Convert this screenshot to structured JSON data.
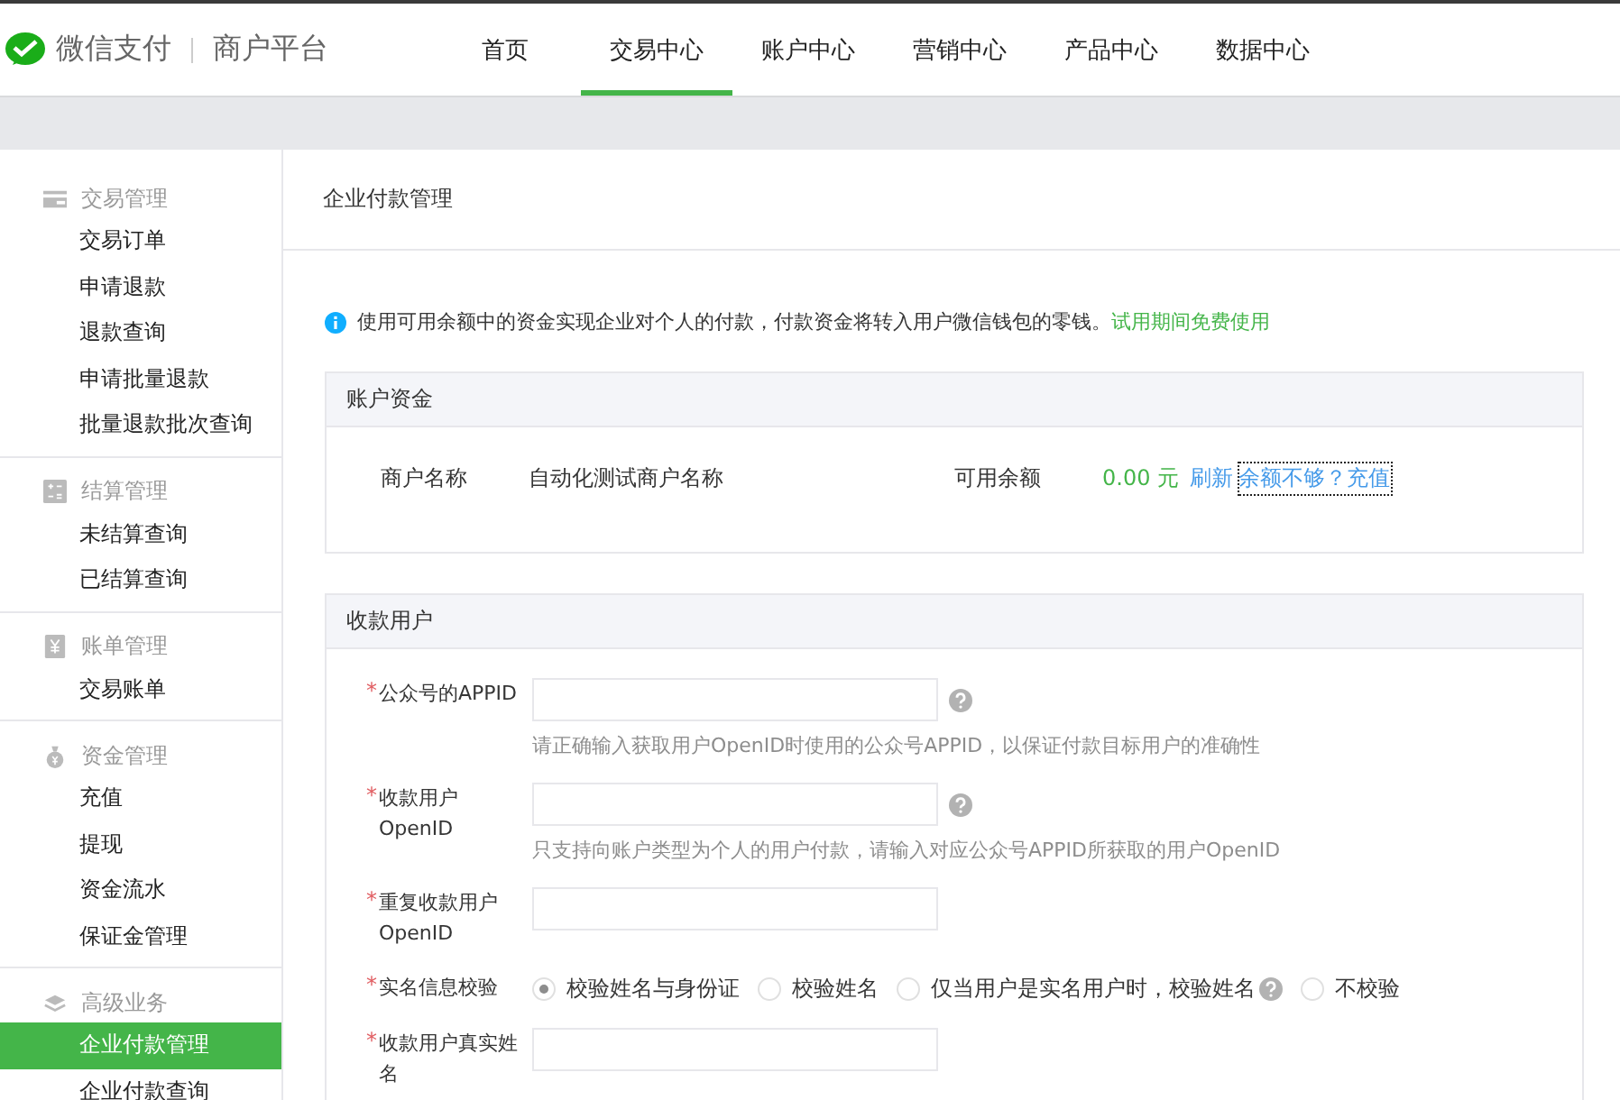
{
  "header": {
    "brand": "微信支付",
    "platform": "商户平台",
    "nav": [
      {
        "label": "首页",
        "selected": false
      },
      {
        "label": "交易中心",
        "selected": true
      },
      {
        "label": "账户中心",
        "selected": false
      },
      {
        "label": "营销中心",
        "selected": false
      },
      {
        "label": "产品中心",
        "selected": false
      },
      {
        "label": "数据中心",
        "selected": false
      }
    ]
  },
  "sidebar": {
    "groups": [
      {
        "title": "交易管理",
        "kind": "card",
        "items": [
          {
            "label": "交易订单",
            "selected": false
          },
          {
            "label": "申请退款",
            "selected": false
          },
          {
            "label": "退款查询",
            "selected": false
          },
          {
            "label": "申请批量退款",
            "selected": false
          },
          {
            "label": "批量退款批次查询",
            "selected": false
          }
        ]
      },
      {
        "title": "结算管理",
        "kind": "calculator",
        "items": [
          {
            "label": "未结算查询",
            "selected": false
          },
          {
            "label": "已结算查询",
            "selected": false
          }
        ]
      },
      {
        "title": "账单管理",
        "kind": "bill",
        "items": [
          {
            "label": "交易账单",
            "selected": false
          }
        ]
      },
      {
        "title": "资金管理",
        "kind": "bag",
        "items": [
          {
            "label": "充值",
            "selected": false
          },
          {
            "label": "提现",
            "selected": false
          },
          {
            "label": "资金流水",
            "selected": false
          },
          {
            "label": "保证金管理",
            "selected": false
          }
        ]
      },
      {
        "title": "高级业务",
        "kind": "layers",
        "items": [
          {
            "label": "企业付款管理",
            "selected": true
          },
          {
            "label": "企业付款查询",
            "selected": false
          }
        ]
      }
    ]
  },
  "content": {
    "title": "企业付款管理",
    "notice": {
      "text": "使用可用余额中的资金实现企业对个人的付款，付款资金将转入用户微信钱包的零钱。",
      "link": "试用期间免费使用"
    },
    "account_panel": {
      "title": "账户资金",
      "name_label": "商户名称",
      "name_value": "自动化测试商户名称",
      "balance_label": "可用余额",
      "balance_value": "0.00 元",
      "refresh": "刷新",
      "recharge": {
        "label": "余额不够？充值",
        "focused": true
      }
    },
    "payee_panel": {
      "title": "收款用户",
      "fields": [
        {
          "kind": "input",
          "label": "公众号的APPID",
          "required_mark": "*",
          "help": true,
          "hint": "请正确输入获取用户OpenID时使用的公众号APPID，以保证付款目标用户的准确性"
        },
        {
          "kind": "input",
          "label": "收款用户OpenID",
          "required_mark": "*",
          "help": true,
          "hint": "只支持向账户类型为个人的用户付款，请输入对应公众号APPID所获取的用户OpenID"
        },
        {
          "kind": "input",
          "label": "重复收款用户OpenID",
          "required_mark": "*",
          "help": false
        },
        {
          "kind": "radio",
          "label": "实名信息校验",
          "required_mark": "*",
          "options": [
            {
              "label": "校验姓名与身份证",
              "selected": true,
              "help": false
            },
            {
              "label": "校验姓名",
              "selected": false,
              "help": false
            },
            {
              "label": "仅当用户是实名用户时，校验姓名",
              "selected": false,
              "help": true
            },
            {
              "label": "不校验",
              "selected": false,
              "help": false
            }
          ]
        },
        {
          "kind": "input",
          "label": "收款用户真实姓名",
          "required_mark": "*",
          "help": false
        }
      ]
    }
  }
}
